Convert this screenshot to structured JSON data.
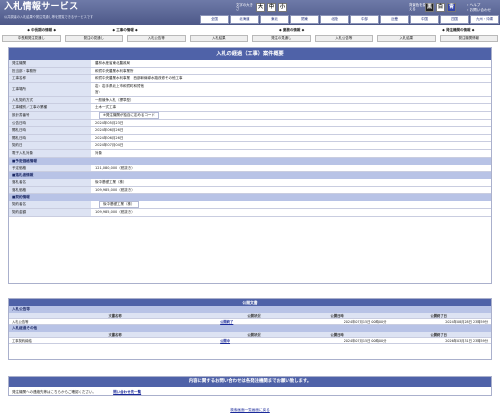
{
  "header": {
    "title": "入札情報サービス",
    "subtitle": "公共調達の入札結果や発注見通し等を閲覧できるサービスです",
    "font_size_label": "文字の大きさ",
    "font_sizes": [
      "大",
      "中",
      "小"
    ],
    "color_label": "背景色を変える",
    "colors": [
      "黒",
      "白",
      "青"
    ],
    "help_link": "ヘルプ",
    "contact_link": "お問い合わせ"
  },
  "regions": [
    "全国",
    "北海道",
    "東北",
    "関東",
    "北陸",
    "中部",
    "近畿",
    "中国",
    "四国",
    "九州・沖縄"
  ],
  "nav": {
    "categories": [
      "中長期の情報",
      "工事の情報",
      "",
      "業務の情報",
      "",
      "発注機関の情報"
    ],
    "links": [
      "中長期発注見通し",
      "発注の見通し",
      "入札公告等",
      "入札結果",
      "発注の見通し",
      "入札公告等",
      "入札結果",
      "発注機関情報"
    ]
  },
  "main": {
    "title": "入札の経過（工事）案件概要",
    "rows": [
      {
        "label": "発注機関",
        "value": "農林水産省東北農政局"
      },
      {
        "label": "担当部・事務所",
        "value": "和賀中央農業水利事業所"
      },
      {
        "label": "工事名称",
        "value": "和賀中央農業水利事業　西部幹線導水路改修その他工事"
      }
    ],
    "location": {
      "label": "工事場所",
      "line1": "岩：岩手県北上市和賀町和賀他",
      "line2": "宮："
    },
    "rows2": [
      {
        "label": "入札契約方式",
        "value": "一般競争入札（標準型）"
      },
      {
        "label": "工事種別／工事の業種",
        "value": "土木一式工事"
      },
      {
        "label": "設計書番号",
        "value": "※発注機関が独自に定めるコード"
      },
      {
        "label": "公告日時",
        "value": "2024年05月23日"
      },
      {
        "label": "開札日時",
        "value": "2024年06月26日"
      },
      {
        "label": "開札日時",
        "value": "2024年06月26日"
      },
      {
        "label": "契約日",
        "value": "2024年07月04日"
      },
      {
        "label": "電子入札対象",
        "value": "対象"
      }
    ],
    "estimate_section": "■予定価格情報",
    "estimate": {
      "label": "予定価格",
      "value": "121,080,000（税抜き）"
    },
    "winner_section": "■落札者情報",
    "winner_rows": [
      {
        "label": "落札者名",
        "value": "後中基礎工業（株）"
      },
      {
        "label": "落札価格",
        "value": "109,985,000（税抜き）"
      }
    ],
    "contract_section": "■契約情報",
    "contract_rows": [
      {
        "label": "契約者名",
        "value": "後中基礎工業（株）"
      },
      {
        "label": "契約金額",
        "value": "109,985,000（税抜き）"
      }
    ]
  },
  "publication": {
    "title": "公開文書",
    "headers": [
      "文書名称",
      "公開状況",
      "公開日時",
      "公開終了日"
    ],
    "groups": [
      {
        "name": "入札公告等",
        "rows": [
          {
            "doc": "入札公告等",
            "status": "公開終了",
            "start": "2024年07月15日 00時00分",
            "end": "2024年08月28日 23時59分"
          }
        ]
      },
      {
        "name": "入札経過その他",
        "rows": [
          {
            "doc": "工事契約締結",
            "status": "公開中",
            "start": "2024年07月15日 00時00分",
            "end": "2026年03月31日 23時59分"
          }
        ]
      }
    ]
  },
  "contact": {
    "title": "内容に関するお問い合わせは各発注機関までお願い致します。",
    "text": "発注機関への連絡先等はこちらからご確認ください。",
    "link": "問い合わせ先一覧"
  },
  "footer": {
    "back_link": "検索画面一覧画面に戻る"
  }
}
